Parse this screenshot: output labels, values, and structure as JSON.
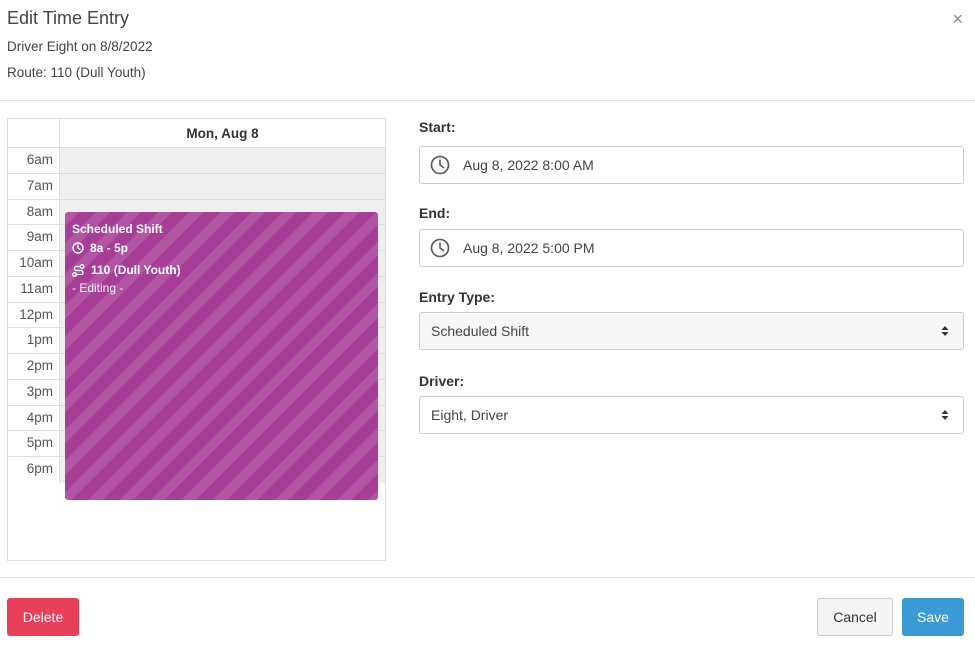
{
  "modal": {
    "title": "Edit Time Entry",
    "subtitle_driver": "Driver Eight on 8/8/2022",
    "subtitle_route": "Route: 110 (Dull Youth)",
    "close_glyph": "×"
  },
  "calendar": {
    "day_header": "Mon, Aug 8",
    "hours": [
      "6am",
      "7am",
      "8am",
      "9am",
      "10am",
      "11am",
      "12pm",
      "1pm",
      "2pm",
      "3pm",
      "4pm",
      "5pm",
      "6pm"
    ],
    "event": {
      "title": "Scheduled Shift",
      "time": "8a - 5p",
      "route": "110 (Dull Youth)",
      "status": "- Editing -",
      "color": "#a63d96",
      "time_icon": "clock-icon",
      "route_icon": "route-icon"
    }
  },
  "form": {
    "start_label": "Start:",
    "start_value": "Aug 8, 2022 8:00 AM",
    "end_label": "End:",
    "end_value": "Aug 8, 2022 5:00 PM",
    "entry_type_label": "Entry Type:",
    "entry_type_value": "Scheduled Shift",
    "driver_label": "Driver:",
    "driver_value": "Eight, Driver"
  },
  "footer": {
    "delete_label": "Delete",
    "cancel_label": "Cancel",
    "save_label": "Save",
    "delete_color": "#e8405a",
    "save_color": "#3a9ad4"
  }
}
